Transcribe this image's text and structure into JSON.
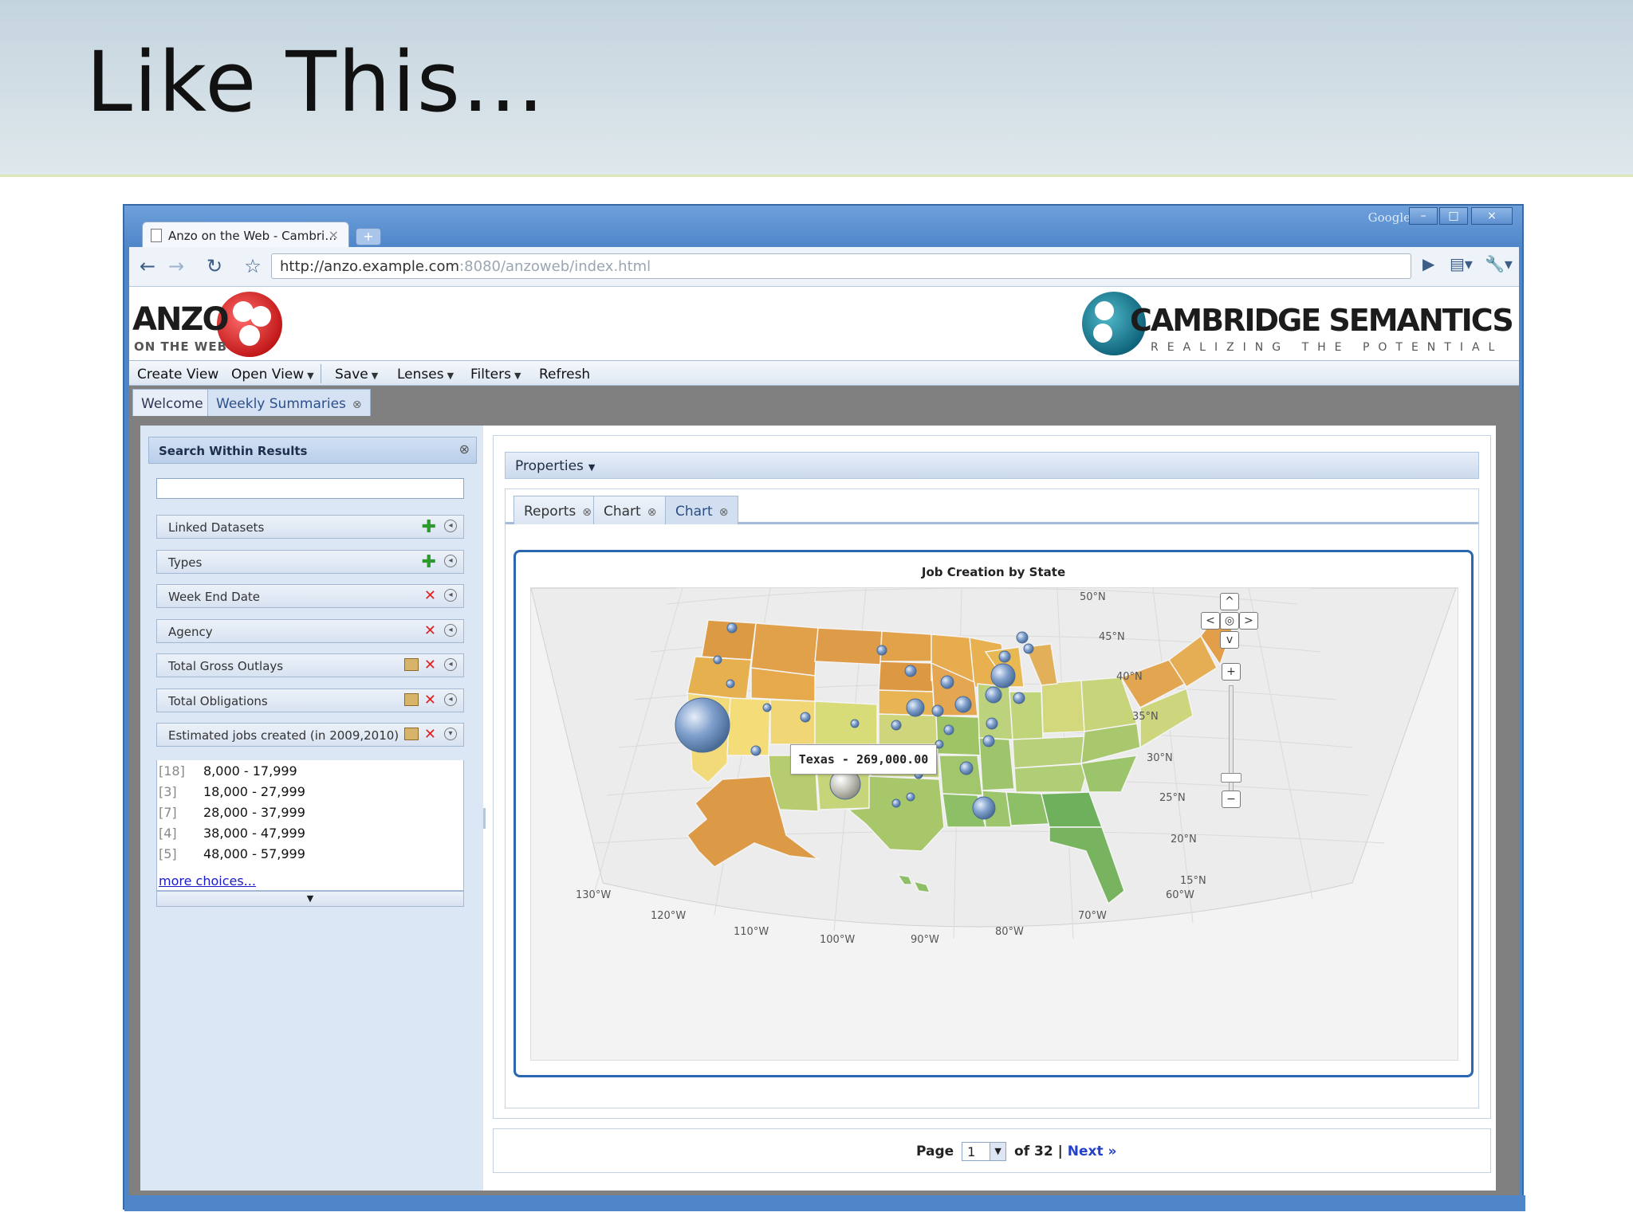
{
  "slide": {
    "title": "Like This…"
  },
  "browser": {
    "brand": "Google",
    "tab_title": "Anzo on the Web - Cambri…",
    "tab_close": "×",
    "new_tab": "+",
    "url_host": "http://anzo.example.com",
    "url_rest": ":8080/anzoweb/index.html",
    "window_buttons": [
      "–",
      "□",
      "×"
    ]
  },
  "app": {
    "logo_left": {
      "name": "ANZO",
      "subtitle": "ON THE WEB"
    },
    "logo_right": {
      "name": "CAMBRIDGE SEMANTICS",
      "tagline": "REALIZING THE POTENTIAL"
    },
    "menu": [
      {
        "label": "Create View",
        "dropdown": false
      },
      {
        "label": "Open View",
        "dropdown": true
      },
      {
        "label": "Save",
        "dropdown": true
      },
      {
        "label": "Lenses",
        "dropdown": true
      },
      {
        "label": "Filters",
        "dropdown": true
      },
      {
        "label": "Refresh",
        "dropdown": false
      }
    ],
    "tabs": [
      {
        "label": "Welcome",
        "active": false
      },
      {
        "label": "Weekly Summaries",
        "active": true
      }
    ]
  },
  "left_panel": {
    "title": "Search Within Results",
    "search_value": "",
    "facets": [
      {
        "label": "Linked Datasets",
        "action": "add"
      },
      {
        "label": "Types",
        "action": "add"
      },
      {
        "label": "Week End Date",
        "action": "remove"
      },
      {
        "label": "Agency",
        "action": "remove"
      },
      {
        "label": "Total Gross Outlays",
        "action": "edit-remove"
      },
      {
        "label": "Total Obligations",
        "action": "edit-remove"
      },
      {
        "label": "Estimated jobs created (in 2009,2010)",
        "action": "edit-remove"
      }
    ],
    "choices": [
      {
        "count": "[18]",
        "range": "8,000 - 17,999"
      },
      {
        "count": "[3]",
        "range": "18,000 - 27,999"
      },
      {
        "count": "[7]",
        "range": "28,000 - 37,999"
      },
      {
        "count": "[4]",
        "range": "38,000 - 47,999"
      },
      {
        "count": "[5]",
        "range": "48,000 - 57,999"
      }
    ],
    "more_label": "more choices..."
  },
  "right_panel": {
    "properties_label": "Properties",
    "inner_tabs": [
      {
        "label": "Reports",
        "active": false
      },
      {
        "label": "Chart",
        "active": false
      },
      {
        "label": "Chart",
        "active": true
      }
    ],
    "chart_title": "Job Creation by State",
    "tooltip": "Texas - 269,000.00",
    "latitudes": [
      "50°N",
      "45°N",
      "40°N",
      "35°N",
      "30°N",
      "25°N",
      "20°N",
      "15°N"
    ],
    "longitudes": [
      "130°W",
      "120°W",
      "110°W",
      "100°W",
      "90°W",
      "80°W",
      "70°W",
      "60°W"
    ],
    "map_controls": {
      "up": "^",
      "left": "<",
      "center": "◎",
      "right": ">",
      "down": "v",
      "zoom_in": "+",
      "zoom_out": "−"
    },
    "pager": {
      "page_label": "Page",
      "current": "1",
      "of_label": "of 32 |",
      "next_label": "Next »"
    }
  },
  "colors": {
    "window_blue": "#4f86c9",
    "accent_blue": "#2b67b0",
    "link_blue": "#1a1ac8",
    "anzo_red": "#c31a1a",
    "cs_teal": "#11667e"
  }
}
